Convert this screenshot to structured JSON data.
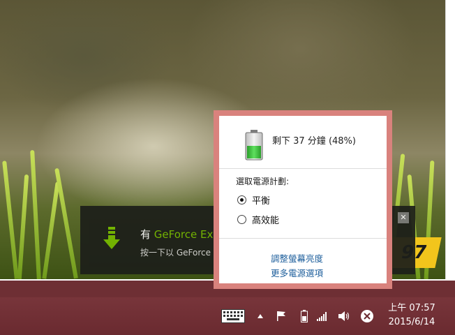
{
  "toast": {
    "title_prefix": "有",
    "title_brand": "GeForce Ex",
    "body": "按一下以 GeForce",
    "close_glyph": "✕"
  },
  "wallpaper_logo_text": "97",
  "power_flyout": {
    "remaining": "剩下 37 分鐘 (48%)",
    "battery_level": 0.48,
    "plan_label": "選取電源計劃:",
    "plans": [
      {
        "label": "平衡",
        "selected": true
      },
      {
        "label": "高效能",
        "selected": false
      }
    ],
    "links": [
      "調整螢幕亮度",
      "更多電源選項"
    ]
  },
  "taskbar": {
    "clock_time": "上午 07:57",
    "clock_date": "2015/6/14",
    "tray_icons": [
      "keyboard-icon",
      "chevron-up-icon",
      "flag-icon",
      "battery-icon",
      "signal-icon",
      "volume-icon",
      "close-circle-icon"
    ]
  },
  "colors": {
    "taskbar": "#7e3a3f",
    "flyout_border": "#d9827d",
    "link": "#1e5f9c",
    "nvidia_green": "#76b900",
    "battery_green": "#3cc83c"
  }
}
